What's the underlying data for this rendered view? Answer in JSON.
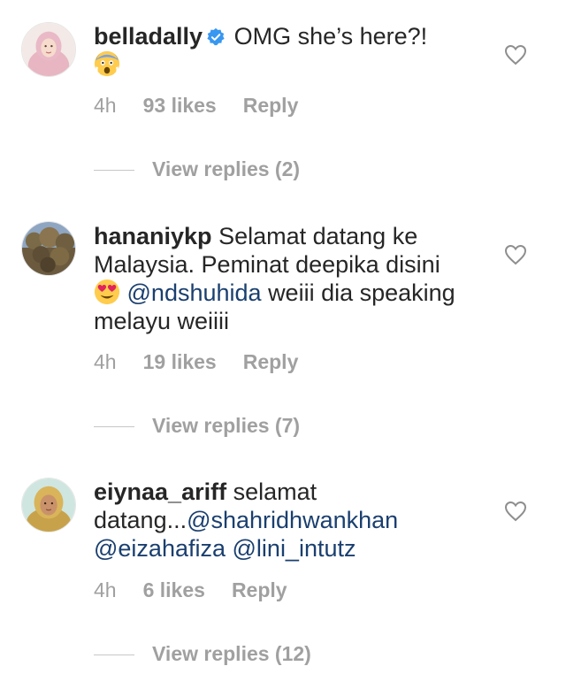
{
  "comments": [
    {
      "username": "belladally",
      "text": "OMG she’s here?!",
      "time": "4h",
      "likes": "93 likes",
      "reply_label": "Reply",
      "view_replies": "View replies (2)"
    },
    {
      "username": "hananiykp",
      "text_part1": "Selamat datang ke Malaysia. Peminat deepika disini",
      "mention": "@ndshuhida",
      "text_part2": "weiii dia speaking melayu weiiii",
      "time": "4h",
      "likes": "19 likes",
      "reply_label": "Reply",
      "view_replies": "View replies (7)"
    },
    {
      "username": "eiynaa_ariff",
      "text_part1": "selamat datang...",
      "mention1": "@shahridhwankhan",
      "mention2": "@eizahafiza",
      "mention3": "@lini_intutz",
      "time": "4h",
      "likes": "6 likes",
      "reply_label": "Reply",
      "view_replies": "View replies (12)"
    }
  ],
  "icons": {
    "heart": "heart-outline-icon",
    "verified": "verified-badge-icon",
    "emoji1": "face-screaming-in-fear-emoji",
    "emoji2": "heart-eyes-emoji"
  },
  "colors": {
    "text": "#262626",
    "meta": "#a0a0a0",
    "mention": "#1a3f6f",
    "verified": "#3897f0"
  }
}
